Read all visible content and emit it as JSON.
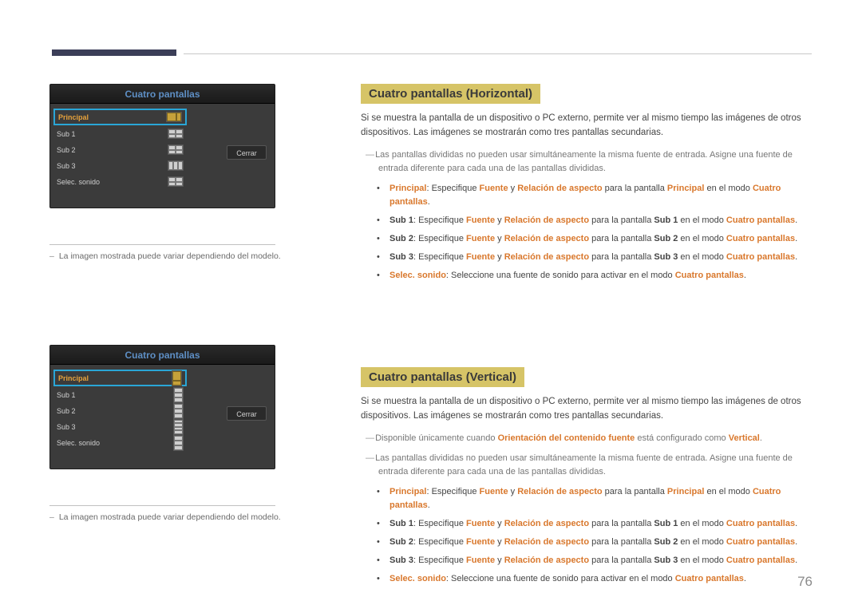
{
  "page_number": "76",
  "left": {
    "tv_title": "Cuatro pantallas",
    "menu": {
      "principal": "Principal",
      "sub1": "Sub 1",
      "sub2": "Sub 2",
      "sub3": "Sub 3",
      "selec": "Selec. sonido"
    },
    "cerrar": "Cerrar",
    "caption": "La imagen mostrada puede variar dependiendo del modelo."
  },
  "sectionH": {
    "title": "Cuatro pantallas (Horizontal)",
    "intro": "Si se muestra la pantalla de un dispositivo o PC externo, permite ver al mismo tiempo las imágenes de otros dispositivos. Las imágenes se mostrarán como tres pantallas secundarias.",
    "note1": "Las pantallas divididas no pueden usar simultáneamente la misma fuente de entrada. Asigne una fuente de entrada diferente para cada una de las pantallas divididas.",
    "b_principal_lead": "Principal",
    "b_txt_especifique": ": Especifique ",
    "b_fuente": "Fuente",
    "b_y": " y ",
    "b_relacion": "Relación de aspecto",
    "b_para_pantalla": " para la pantalla ",
    "b_sub1": "Sub 1",
    "b_sub2": "Sub 2",
    "b_sub3": "Sub 3",
    "b_en_modo": " en el modo ",
    "b_cuatro": "Cuatro pantallas",
    "b_dot": ".",
    "b_selec_lead": "Selec. sonido",
    "b_selec_txt": ": Seleccione una fuente de sonido para activar en el modo "
  },
  "sectionV": {
    "title": "Cuatro pantallas (Vertical)",
    "intro": "Si se muestra la pantalla de un dispositivo o PC externo, permite ver al mismo tiempo las imágenes de otros dispositivos. Las imágenes se mostrarán como tres pantallas secundarias.",
    "note0_a": "Disponible únicamente cuando ",
    "note0_hl": "Orientación del contenido fuente",
    "note0_b": " está configurado como ",
    "note0_hl2": "Vertical",
    "note0_c": ".",
    "note1": "Las pantallas divididas no pueden usar simultáneamente la misma fuente de entrada. Asigne una fuente de entrada diferente para cada una de las pantallas divididas."
  }
}
